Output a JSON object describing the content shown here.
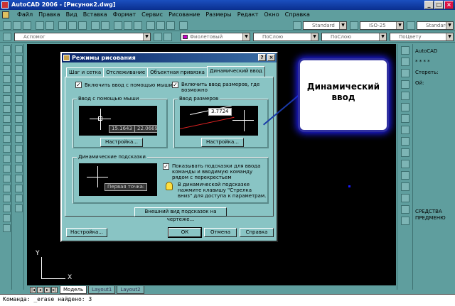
{
  "window": {
    "title": "AutoCAD 2006 - [Рисунок2.dwg]",
    "controls": [
      "_",
      "□",
      "×"
    ]
  },
  "menu": [
    "Файл",
    "Правка",
    "Вид",
    "Вставка",
    "Формат",
    "Сервис",
    "Рисование",
    "Размеры",
    "Редакт",
    "Окно",
    "Справка"
  ],
  "toolbar": {
    "textstyle": "Standard",
    "dimstyle": "ISO-25",
    "tablestyle": "Standard",
    "layer": "Аспомог",
    "color": "Фиолетовый",
    "linetype": "ПоСлою",
    "lineweight": "ПоСлою",
    "plotstyle": "ПоЦвету"
  },
  "drawing": {
    "ucs_x": "X",
    "ucs_y": "Y"
  },
  "layout_tabs": [
    "Модель",
    "Layout1",
    "Layout2"
  ],
  "command_line": "Команда: _erase найдено: 3",
  "right_panel": {
    "title": "AutoCAD",
    "dots": "* * * *",
    "erase": "Стереть:",
    "ojoy": "Ой:",
    "props_line1": "СРЕДСТВА",
    "props_line2": "ПРЕДМЕНЮ"
  },
  "dialog": {
    "title": "Режимы рисования",
    "help_btn": "?",
    "close_btn": "×",
    "tabs": [
      "Шаг и сетка",
      "Отслеживание",
      "Объектная привязка",
      "Динамический ввод"
    ],
    "enable_pointer_input": "Включить ввод с помощью мыши",
    "enable_dim_input": "Включить ввод размеров, где возможно",
    "pointer_group": "Ввод с помощью мыши",
    "pointer_val1": "15.1643",
    "pointer_val2": "22.0669",
    "pointer_settings": "Настройка...",
    "dim_group": "Ввод размеров",
    "dim_val": "3.7724",
    "dim_settings": "Настройка...",
    "prompts_group": "Динамические подсказки",
    "prompt_tip": "Первая точка:",
    "show_prompts": "Показывать подсказки для ввода команды и вводимую команду рядом с перекрестьем",
    "hint": "В динамической подсказке нажмите клавишу \"Стрелка вниз\" для доступа к параметрам.",
    "appearance_btn": "Внешний вид подсказок на чертеже...",
    "options_btn": "Настройка...",
    "ok": "ОК",
    "cancel": "Отмена",
    "help": "Справка"
  },
  "callout": {
    "text": "Динамический ввод"
  }
}
